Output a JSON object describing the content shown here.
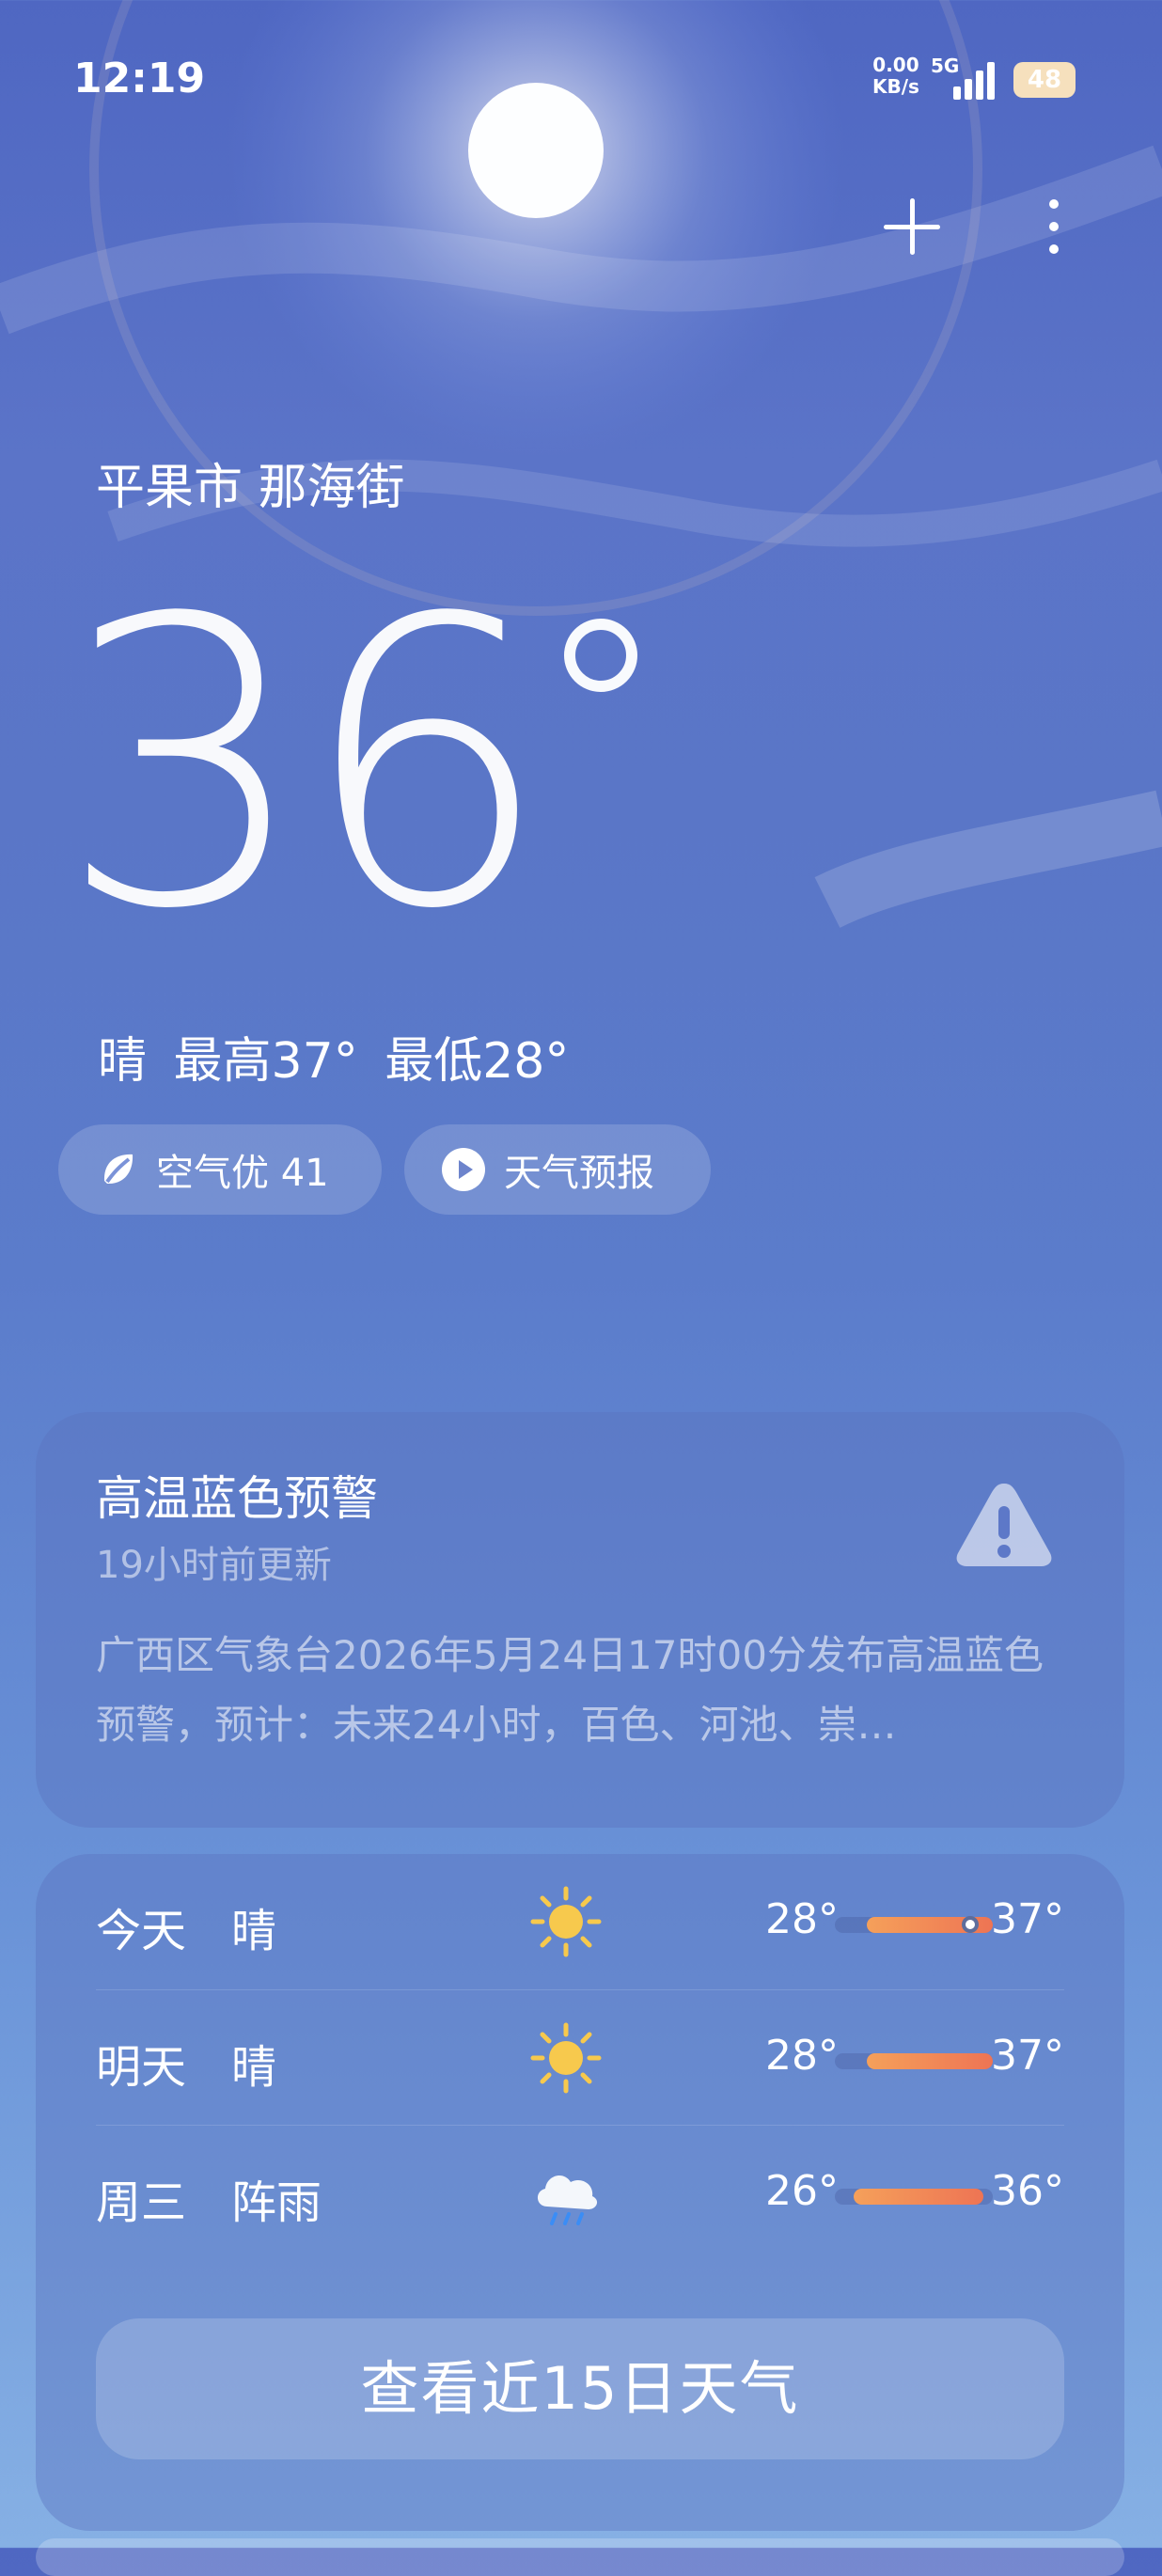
{
  "status_bar": {
    "time": "12:19",
    "net_speed": "0.00",
    "net_unit": "KB/s",
    "network": "5G",
    "battery": "48"
  },
  "header": {
    "location": "平果市 那海街",
    "temperature": "36"
  },
  "current": {
    "summary": "晴   最高37° 最低28°",
    "air_quality": "空气优 41",
    "forecast_video": "天气预报"
  },
  "warning": {
    "title": "高温蓝色预警",
    "updated": "19小时前更新",
    "text": "广西区气象台2026年5月24日17时00分发布高温蓝色预警，预计：未来24小时，百色、河池、崇…"
  },
  "forecast": {
    "rows": [
      {
        "day": "今天",
        "condition": "晴",
        "icon": "sun-icon",
        "low": "28°",
        "high": "37°",
        "range": {
          "start": 0.2,
          "end": 1.0,
          "current": 0.86
        }
      },
      {
        "day": "明天",
        "condition": "晴",
        "icon": "sun-icon",
        "low": "28°",
        "high": "37°",
        "range": {
          "start": 0.2,
          "end": 1.0
        }
      },
      {
        "day": "周三",
        "condition": "阵雨",
        "icon": "rain-cloud-icon",
        "low": "26°",
        "high": "36°",
        "range": {
          "start": 0.12,
          "end": 0.94
        }
      }
    ],
    "more_label": "查看近15日天气"
  },
  "colors": {
    "sky_top": "#4f67c2",
    "sky_bottom": "#86b0e4",
    "temperature_bar": "#ee7454",
    "sun": "#f7c94d"
  }
}
